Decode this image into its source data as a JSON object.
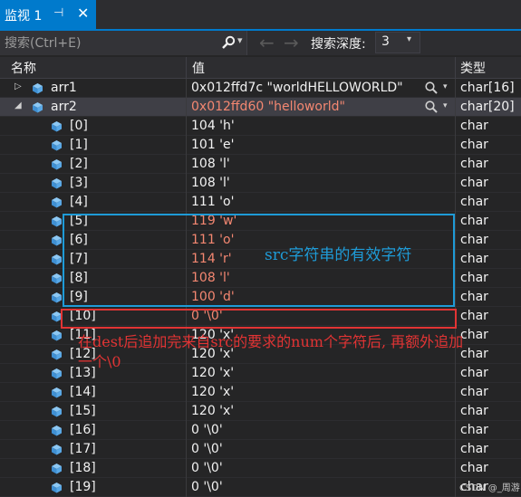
{
  "tab": {
    "title": "监视 1",
    "pin_glyph": "⊣",
    "close_glyph": "✕"
  },
  "toolbar": {
    "search_placeholder": "搜索(Ctrl+E)",
    "search_dropdown_glyph": "▾",
    "back_glyph": "←",
    "forward_glyph": "→",
    "depth_label": "搜索深度:",
    "depth_value": "3",
    "depth_dropdown_glyph": "▾"
  },
  "columns": {
    "name": "名称",
    "value": "值",
    "type": "类型"
  },
  "colors": {
    "accent": "#007acc",
    "changed_value": "#f48771",
    "annotation_blue": "#1e9bd7",
    "annotation_red": "#e23434",
    "object_icon": "#59a8e6"
  },
  "rows": [
    {
      "name": "arr1",
      "value": "0x012ffd7c \"worldHELLOWORLD\"",
      "type": "char[16]",
      "level": 0,
      "expander": "▷",
      "viewer": true,
      "changed": false,
      "selected": false
    },
    {
      "name": "arr2",
      "value": "0x012ffd60 \"helloworld\"",
      "type": "char[20]",
      "level": 0,
      "expander": "◢",
      "viewer": true,
      "changed": true,
      "selected": true
    },
    {
      "name": "[0]",
      "value": "104 'h'",
      "type": "char",
      "level": 1,
      "changed": false
    },
    {
      "name": "[1]",
      "value": "101 'e'",
      "type": "char",
      "level": 1,
      "changed": false
    },
    {
      "name": "[2]",
      "value": "108 'l'",
      "type": "char",
      "level": 1,
      "changed": false
    },
    {
      "name": "[3]",
      "value": "108 'l'",
      "type": "char",
      "level": 1,
      "changed": false
    },
    {
      "name": "[4]",
      "value": "111 'o'",
      "type": "char",
      "level": 1,
      "changed": false
    },
    {
      "name": "[5]",
      "value": "119 'w'",
      "type": "char",
      "level": 1,
      "changed": true
    },
    {
      "name": "[6]",
      "value": "111 'o'",
      "type": "char",
      "level": 1,
      "changed": true
    },
    {
      "name": "[7]",
      "value": "114 'r'",
      "type": "char",
      "level": 1,
      "changed": true
    },
    {
      "name": "[8]",
      "value": "108 'l'",
      "type": "char",
      "level": 1,
      "changed": true
    },
    {
      "name": "[9]",
      "value": "100 'd'",
      "type": "char",
      "level": 1,
      "changed": true
    },
    {
      "name": "[10]",
      "value": "0 '\\0'",
      "type": "char",
      "level": 1,
      "changed": true
    },
    {
      "name": "[11]",
      "value": "120 'x'",
      "type": "char",
      "level": 1,
      "changed": false
    },
    {
      "name": "[12]",
      "value": "120 'x'",
      "type": "char",
      "level": 1,
      "changed": false
    },
    {
      "name": "[13]",
      "value": "120 'x'",
      "type": "char",
      "level": 1,
      "changed": false
    },
    {
      "name": "[14]",
      "value": "120 'x'",
      "type": "char",
      "level": 1,
      "changed": false
    },
    {
      "name": "[15]",
      "value": "120 'x'",
      "type": "char",
      "level": 1,
      "changed": false
    },
    {
      "name": "[16]",
      "value": "0 '\\0'",
      "type": "char",
      "level": 1,
      "changed": false
    },
    {
      "name": "[17]",
      "value": "0 '\\0'",
      "type": "char",
      "level": 1,
      "changed": false
    },
    {
      "name": "[18]",
      "value": "0 '\\0'",
      "type": "char",
      "level": 1,
      "changed": false
    },
    {
      "name": "[19]",
      "value": "0 '\\0'",
      "type": "char",
      "level": 1,
      "changed": false
    }
  ],
  "annotations": {
    "blue_note": "src字符串的有效字符",
    "red_note": "在dest后追加完来自src的要求的num个字符后, 再额外追加一个\\0"
  },
  "watermark": "CSDN @_周游"
}
